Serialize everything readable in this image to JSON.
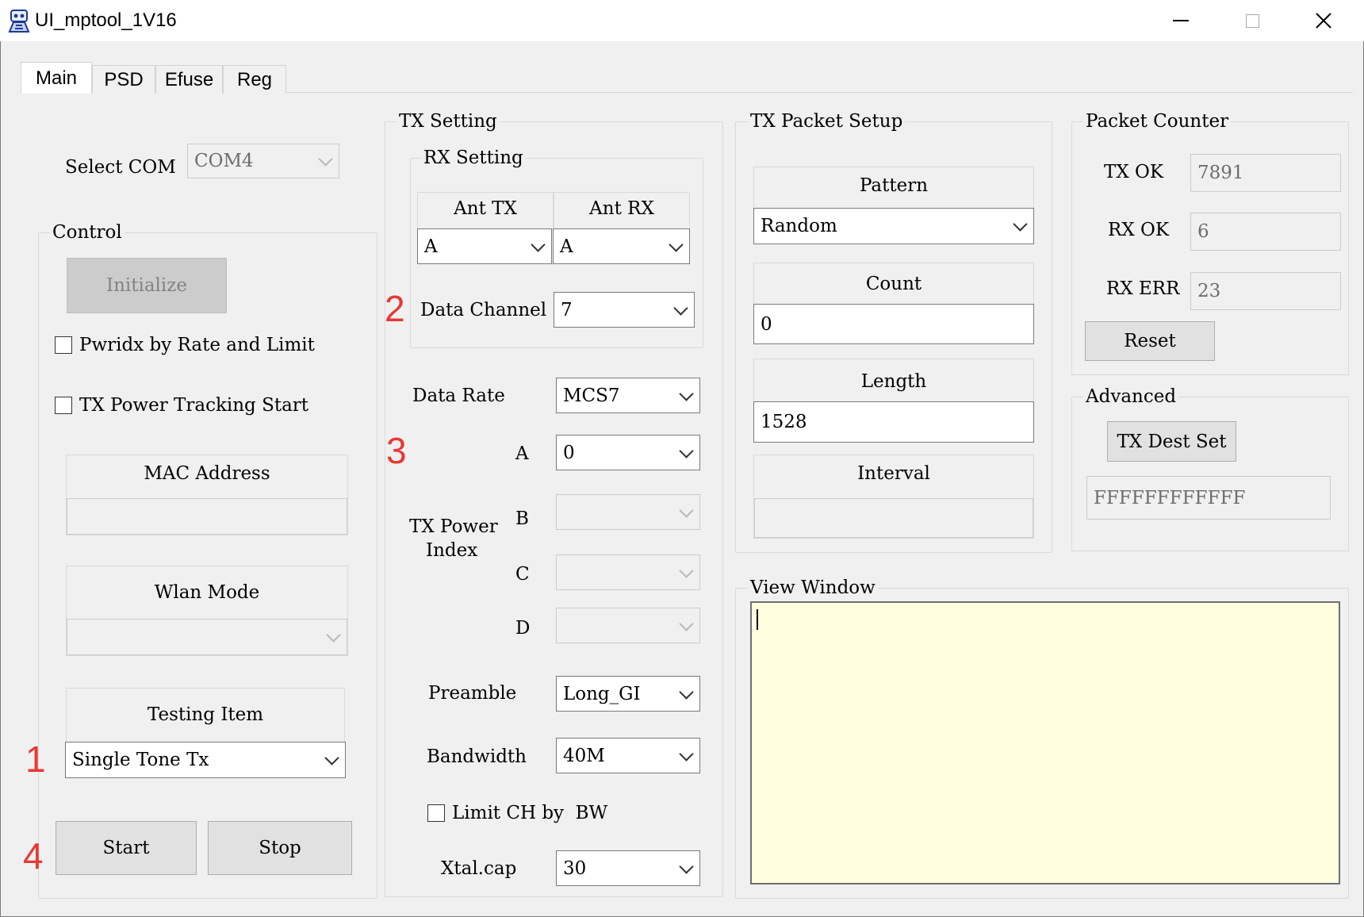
{
  "window": {
    "title": "UI_mptool_1V16"
  },
  "tabs": [
    "Main",
    "PSD",
    "Efuse",
    "Reg"
  ],
  "select_com": {
    "label": "Select COM",
    "value": "COM4"
  },
  "control": {
    "title": "Control",
    "initialize_label": "Initialize",
    "pwridx_label": "Pwridx by Rate and Limit",
    "tracking_label": "TX Power Tracking Start",
    "mac_address_label": "MAC Address",
    "mac_address_value": "",
    "wlan_mode_label": "Wlan Mode",
    "wlan_mode_value": "",
    "testing_item_label": "Testing Item",
    "testing_item_value": "Single Tone Tx",
    "start_label": "Start",
    "stop_label": "Stop"
  },
  "tx_setting": {
    "title": "TX Setting",
    "rx_setting_title": "RX Setting",
    "ant_tx_label": "Ant TX",
    "ant_rx_label": "Ant RX",
    "ant_tx_value": "A",
    "ant_rx_value": "A",
    "data_channel_label": "Data Channel",
    "data_channel_value": "7",
    "data_rate_label": "Data Rate",
    "data_rate_value": "MCS7",
    "tx_power_index_label_1": "TX Power",
    "tx_power_index_label_2": "Index",
    "power_a_label": "A",
    "power_a_value": "0",
    "power_b_label": "B",
    "power_c_label": "C",
    "power_d_label": "D",
    "preamble_label": "Preamble",
    "preamble_value": "Long_GI",
    "bandwidth_label": "Bandwidth",
    "bandwidth_value": "40M",
    "limit_ch_label": "Limit CH by  BW",
    "xtal_label": "Xtal.cap",
    "xtal_value": "30"
  },
  "tx_packet_setup": {
    "title": "TX Packet Setup",
    "pattern_label": "Pattern",
    "pattern_value": "Random",
    "count_label": "Count",
    "count_value": "0",
    "length_label": "Length",
    "length_value": "1528",
    "interval_label": "Interval",
    "interval_value": ""
  },
  "packet_counter": {
    "title": "Packet Counter",
    "tx_ok_label": "TX OK",
    "tx_ok_value": "7891",
    "rx_ok_label": "RX OK",
    "rx_ok_value": "6",
    "rx_err_label": "RX ERR",
    "rx_err_value": "23",
    "reset_label": "Reset"
  },
  "advanced": {
    "title": "Advanced",
    "tx_dest_set_label": "TX Dest Set",
    "dest_value": "FFFFFFFFFFFF"
  },
  "view_window": {
    "title": "View Window",
    "content": ""
  },
  "annotations": {
    "mark_1": "1",
    "mark_2": "2",
    "mark_3": "3",
    "mark_4": "4",
    "color": "#e53935"
  }
}
